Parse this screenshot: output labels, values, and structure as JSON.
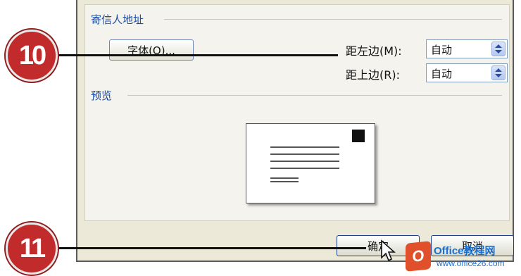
{
  "sender_section": {
    "title": "寄信人地址"
  },
  "font_button": {
    "label": "字体(O)..."
  },
  "margin_left": {
    "label": "距左边(M):",
    "value": "自动"
  },
  "margin_top": {
    "label": "距上边(R):",
    "value": "自动"
  },
  "preview_section": {
    "title": "预览"
  },
  "buttons": {
    "ok": "确定",
    "cancel": "取消"
  },
  "callouts": {
    "first": "10",
    "second": "11"
  },
  "watermark": {
    "brand": "Office教程网",
    "url": "www.office26.com"
  }
}
